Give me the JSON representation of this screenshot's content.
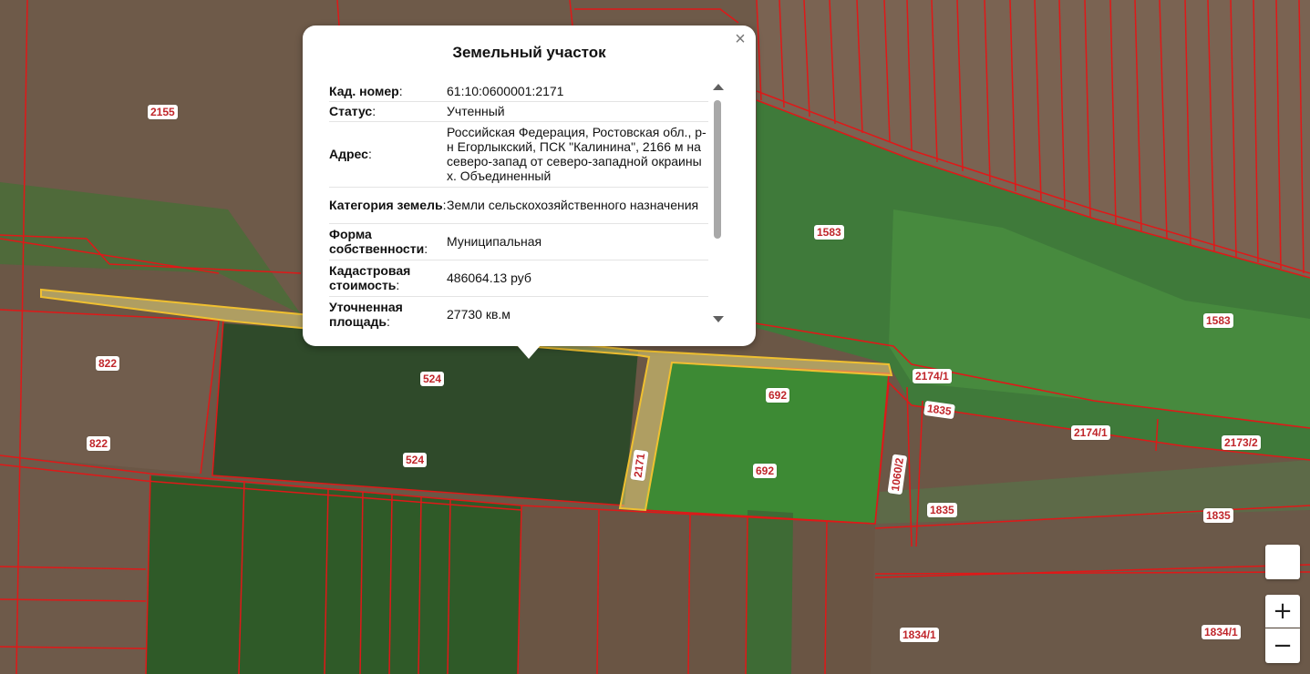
{
  "popup": {
    "title": "Земельный участок",
    "close_glyph": "×",
    "rows": [
      {
        "label": "Кад. номер",
        "value": "61:10:0600001:2171"
      },
      {
        "label": "Статус",
        "value": "Учтенный"
      },
      {
        "label": "Адрес",
        "value": "Российская Федерация, Ростовская обл., р-н Егорлыкский, ПСК \"Калинина\", 2166 м на северо-запад от северо-западной окраины х. Объединенный"
      },
      {
        "label": "Категория земель",
        "value": "Земли сельскохозяйственного назначения"
      },
      {
        "label": "Форма собственности",
        "value": "Муниципальная"
      },
      {
        "label": "Кадастровая стоимость",
        "value": "486064.13 руб"
      },
      {
        "label": "Уточненная площадь",
        "value": "27730 кв.м"
      }
    ]
  },
  "parcel_labels": [
    {
      "id": "l2155",
      "text": "2155"
    },
    {
      "id": "l1583a",
      "text": "1583"
    },
    {
      "id": "l1583b",
      "text": "1583"
    },
    {
      "id": "l822a",
      "text": "822"
    },
    {
      "id": "l822b",
      "text": "822"
    },
    {
      "id": "l524a",
      "text": "524"
    },
    {
      "id": "l524b",
      "text": "524"
    },
    {
      "id": "l2171",
      "text": "2171"
    },
    {
      "id": "l692a",
      "text": "692"
    },
    {
      "id": "l692b",
      "text": "692"
    },
    {
      "id": "l2174a",
      "text": "2174/1"
    },
    {
      "id": "l1835a",
      "text": "1835"
    },
    {
      "id": "l2174b",
      "text": "2174/1"
    },
    {
      "id": "l2173",
      "text": "2173/2"
    },
    {
      "id": "l1060",
      "text": "1060/2"
    },
    {
      "id": "l1835b",
      "text": "1835"
    },
    {
      "id": "l1835c",
      "text": "1835"
    },
    {
      "id": "l1834a",
      "text": "1834/1"
    },
    {
      "id": "l1834b",
      "text": "1834/1"
    }
  ],
  "controls": {
    "zoom_in": "+",
    "zoom_out": "−"
  },
  "colors": {
    "boundary": "#e01818",
    "selected_fill": "#e8d97a",
    "selected_stroke": "#f0c030"
  }
}
